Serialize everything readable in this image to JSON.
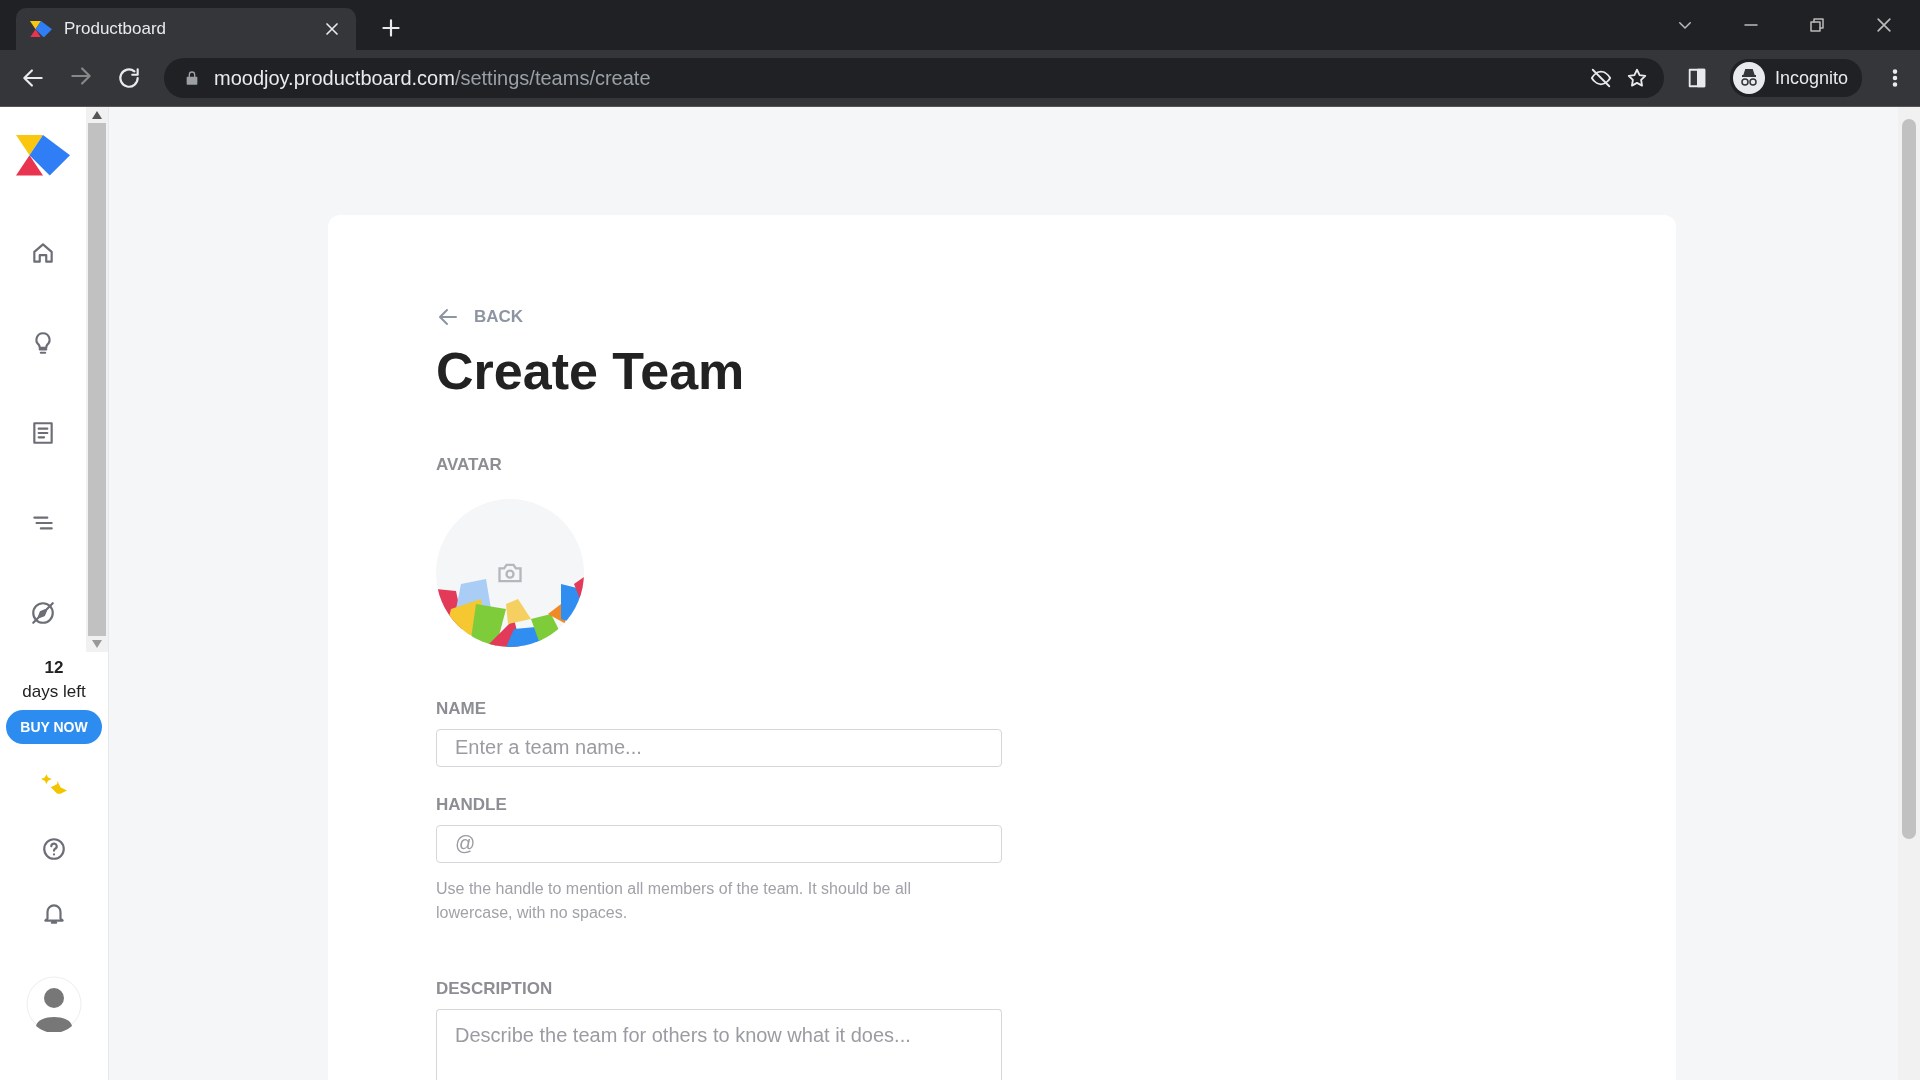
{
  "browser": {
    "tab_title": "Productboard",
    "url_host": "moodjoy.productboard.com",
    "url_path": "/settings/teams/create",
    "profile": "Incognito"
  },
  "sidebar": {
    "trial_days": "12",
    "trial_label": "days left",
    "buy_button": "BUY NOW"
  },
  "page": {
    "back": "BACK",
    "title": "Create Team",
    "avatar_label": "AVATAR",
    "fields": [
      {
        "kind": "input",
        "label": "NAME",
        "placeholder": "Enter a team name..."
      },
      {
        "kind": "input",
        "label": "HANDLE",
        "placeholder": "@",
        "help": "Use the handle to mention all members of the team. It should be all lowercase, with no spaces."
      },
      {
        "kind": "textarea",
        "label": "DESCRIPTION",
        "placeholder": "Describe the team for others to know what it does..."
      }
    ]
  }
}
